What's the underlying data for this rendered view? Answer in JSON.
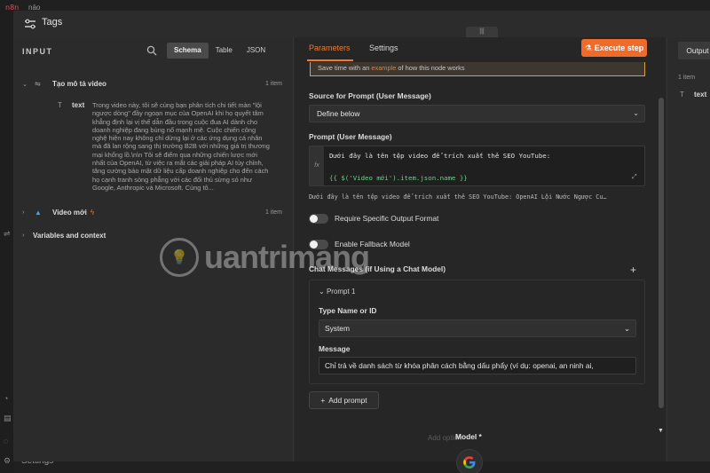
{
  "app": {
    "logo_text": "n8n",
    "tab_text": "nāo",
    "settings_label": "Settings",
    "bottom_ghost": "Model"
  },
  "modal": {
    "title": "Tags"
  },
  "input_panel": {
    "title": "INPUT",
    "view_tabs": [
      "Schema",
      "Table",
      "JSON"
    ],
    "nodes": [
      {
        "name": "Tạo mô tả video",
        "count": "1 item"
      },
      {
        "name": "Video mới",
        "count": "1 item"
      },
      {
        "name": "Variables and context",
        "count": ""
      }
    ],
    "field": {
      "name": "text",
      "value": "Trong video này, tôi sẽ cùng bạn phân tích chi tiết màn \"lội ngược dòng\" đầy ngoạn mục của OpenAI khi họ quyết tâm khẳng định lại vị thế dẫn đầu trong cuộc đua AI dành cho doanh nghiệp đang bùng nổ mạnh mẽ. Cuộc chiến công nghệ hiện nay không chỉ dừng lại ở các ứng dụng cá nhân mà đã lan rộng sang thị trường B2B với những giá trị thương mại khổng lồ.\\n\\n Tôi sẽ điểm qua những chiến lược mới nhất của OpenAI, từ việc ra mắt các giải pháp AI tùy chỉnh, tăng cường bảo mật dữ liệu cấp doanh nghiệp cho đến cách họ cạnh tranh sòng phẳng với các đối thủ sừng sỏ như Google, Anthropic và Microsoft. Cùng tô..."
    }
  },
  "center_panel": {
    "tabs": [
      "Parameters",
      "Settings"
    ],
    "execute_label": "Execute step",
    "notice_prefix": "Save time with an ",
    "notice_link": "example",
    "notice_suffix": " of how this node works",
    "source_label": "Source for Prompt (User Message)",
    "source_value": "Define below",
    "prompt_label": "Prompt (User Message)",
    "code_line1": "Dưới đây là tên tệp video để trích xuất thẻ SEO YouTube:",
    "code_line2": "{{ $('Video mới').item.json.name }}",
    "preview": "Dưới đây là tên tệp video để trích xuất thẻ SEO YouTube: OpenAI Lội Nước Ngược Cu…",
    "toggle1": "Require Specific Output Format",
    "toggle2": "Enable Fallback Model",
    "chat_messages_label": "Chat Messages (if Using a Chat Model)",
    "prompt_item": "Prompt 1",
    "type_label": "Type Name or ID",
    "type_value": "System",
    "message_label": "Message",
    "message_value": "Chỉ trả về danh sách từ khóa phân cách bằng dấu phẩy (ví dụ: openai, an ninh ai,",
    "add_prompt": "Add prompt",
    "faded_bottom": "Add option"
  },
  "output_panel": {
    "tab": "Output",
    "count": "1 item",
    "field": "text"
  },
  "model": {
    "label": "Model *"
  },
  "watermark": {
    "text": "uantrimang"
  },
  "colors": {
    "accent": "#f06a2a",
    "background": "#262626",
    "panel": "#2b2b2b"
  }
}
